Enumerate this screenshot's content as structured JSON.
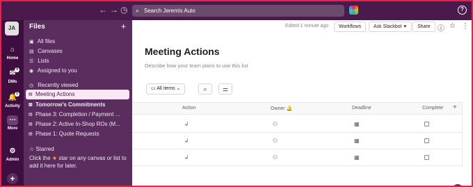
{
  "topbar": {
    "back": "←",
    "forward": "→",
    "history": "◷",
    "search_placeholder": "Search Jeremis Auto",
    "search_icon": "⌕",
    "help": "?"
  },
  "rail": {
    "avatar": "JA",
    "items": [
      {
        "label": "Home",
        "icon": "⌂"
      },
      {
        "label": "DMs",
        "icon": "✉",
        "badge": "9"
      },
      {
        "label": "Activity",
        "icon": "🔔",
        "badge": "5"
      },
      {
        "label": "More",
        "icon": "⋯"
      },
      {
        "label": "Admin",
        "icon": "⚙"
      }
    ],
    "add": "+"
  },
  "files": {
    "title": "Files",
    "add": "+",
    "items": [
      {
        "label": "All files",
        "icon": "▣"
      },
      {
        "label": "Canvases",
        "icon": "▤"
      },
      {
        "label": "Lists",
        "icon": "☰"
      },
      {
        "label": "Assigned to you",
        "icon": "◉"
      }
    ],
    "recent_title": "Recently viewed",
    "recent_icon": "◷",
    "recent": [
      "Meeting Actions",
      "Tomorrow's Commitments",
      "Phase 3: Completion / Payment ...",
      "Phase 2: Active In-Shop ROs (M...",
      "Phase 1: Quote Requests"
    ],
    "recent_icon_item": "▤",
    "starred_title": "Starred",
    "starred_icon": "☆",
    "starred_help_before": "Click the",
    "starred_help_star": "★",
    "starred_help_after": "star on any canvas or list to add it here for later."
  },
  "main": {
    "edited": "Edited 1 minute ago",
    "workflows": "Workflows",
    "ask_slackbot": "Ask Slackbot ✦",
    "share": "Share",
    "info_icon": "ⓘ",
    "star_icon": "☆",
    "more_icon": "⋮",
    "title": "Meeting Actions",
    "description": "Describe how your team plans to use this list",
    "view": "All items",
    "view_icon": "▭",
    "view_chevron": "⌄",
    "search_icon": "⌕",
    "filter_icon": "⚌",
    "columns": [
      "Action",
      "Owner",
      "Deadline",
      "Complete"
    ],
    "owner_icon": "🔔",
    "add_column": "+",
    "row_icons": {
      "action": "↲",
      "owner": "⚇",
      "deadline": "▦"
    },
    "row_count": 3
  }
}
